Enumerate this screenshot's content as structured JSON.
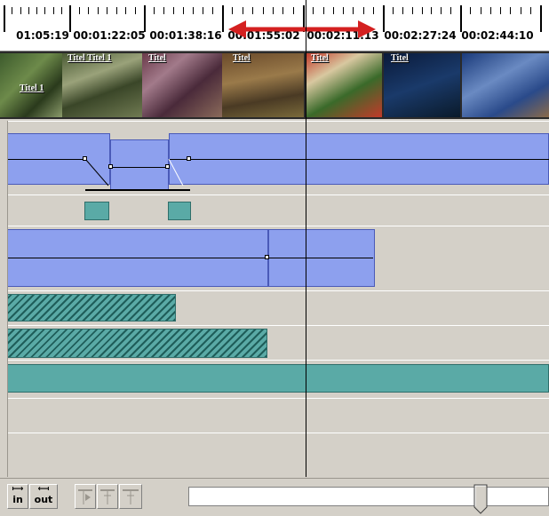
{
  "ruler": {
    "timecodes": [
      "01:05:19",
      "00:01:22:05",
      "00:01:38:16",
      "00:01:55:02",
      "00:02:11:13",
      "00:02:27:24",
      "00:02:44:10"
    ]
  },
  "thumbnails": {
    "titles": [
      "Titel Titel 1",
      "Titel 1",
      "Titel",
      "Titel",
      "Titel",
      "Titel"
    ]
  },
  "toolbar": {
    "in_label": "in",
    "out_label": "out"
  },
  "colors": {
    "clip_blue": "#8da0ee",
    "teal": "#5aaaa6",
    "arrow_red": "#d42020"
  }
}
